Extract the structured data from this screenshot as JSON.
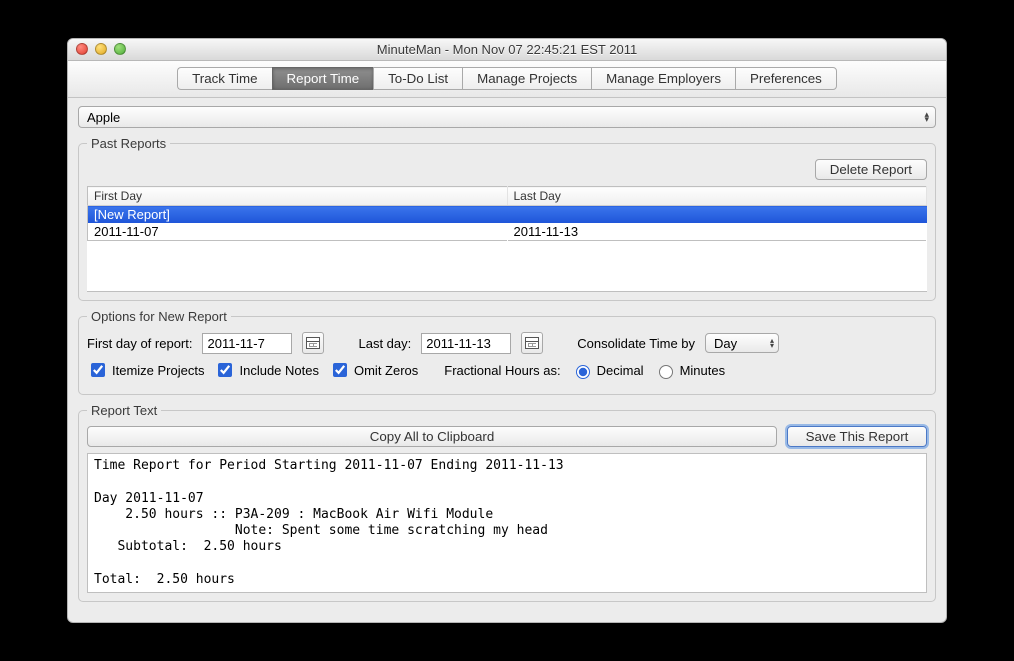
{
  "window": {
    "title": "MinuteMan - Mon Nov 07 22:45:21 EST 2011"
  },
  "tabs": {
    "items": [
      {
        "label": "Track Time"
      },
      {
        "label": "Report Time"
      },
      {
        "label": "To-Do List"
      },
      {
        "label": "Manage Projects"
      },
      {
        "label": "Manage Employers"
      },
      {
        "label": "Preferences"
      }
    ],
    "active_index": 1
  },
  "employer_select": {
    "value": "Apple"
  },
  "past_reports": {
    "legend": "Past Reports",
    "delete_label": "Delete Report",
    "columns": [
      "First Day",
      "Last Day"
    ],
    "rows": [
      {
        "first": "[New Report]",
        "last": "",
        "selected": true
      },
      {
        "first": "2011-11-07",
        "last": "2011-11-13",
        "selected": false
      }
    ]
  },
  "options": {
    "legend": "Options for New Report",
    "first_day_label": "First day of report:",
    "first_day_value": "2011-11-7",
    "last_day_label": "Last day:",
    "last_day_value": "2011-11-13",
    "consolidate_label": "Consolidate Time by",
    "consolidate_value": "Day",
    "itemize_label": "Itemize Projects",
    "itemize_checked": true,
    "notes_label": "Include Notes",
    "notes_checked": true,
    "omit_label": "Omit Zeros",
    "omit_checked": true,
    "fractional_label": "Fractional Hours as:",
    "fractional_value": "Decimal",
    "fractional_options": [
      "Decimal",
      "Minutes"
    ]
  },
  "report": {
    "legend": "Report Text",
    "copy_label": "Copy All to Clipboard",
    "save_label": "Save This Report",
    "text": "Time Report for Period Starting 2011-11-07 Ending 2011-11-13\n\nDay 2011-11-07\n    2.50 hours :: P3A-209 : MacBook Air Wifi Module\n                  Note: Spent some time scratching my head\n   Subtotal:  2.50 hours\n\nTotal:  2.50 hours"
  }
}
